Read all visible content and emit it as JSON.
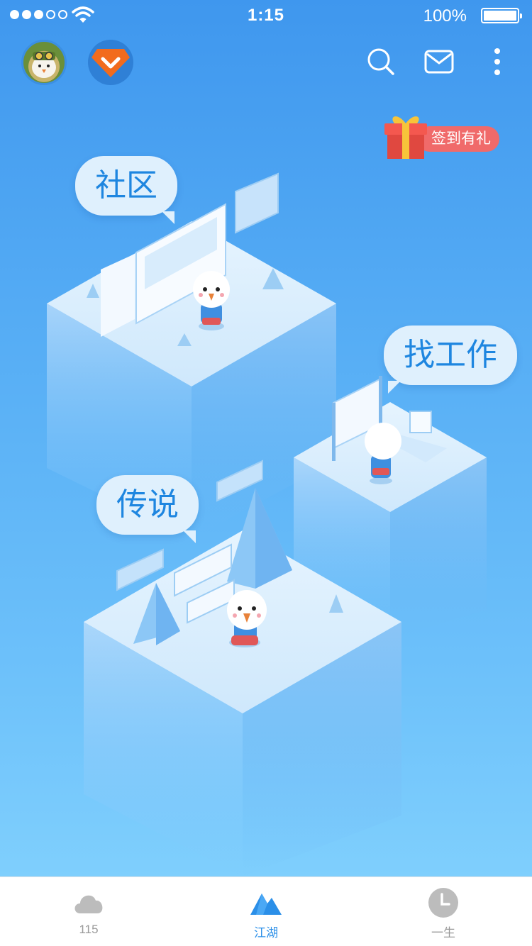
{
  "status_bar": {
    "time": "1:15",
    "battery_text": "100%",
    "signal_bars_filled": 3,
    "signal_bars_total": 5
  },
  "top_bar": {
    "icons": [
      "avatar",
      "vip-diamond-icon",
      "search-icon",
      "mail-icon",
      "more-vertical-icon"
    ]
  },
  "gift": {
    "label": "签到有礼"
  },
  "sections": {
    "community": "社区",
    "job": "找工作",
    "legend": "传说"
  },
  "tab_bar": {
    "tabs": [
      {
        "label": "115",
        "icon": "cloud-icon"
      },
      {
        "label": "江湖",
        "icon": "mountain-icon"
      },
      {
        "label": "一生",
        "icon": "clock-icon"
      }
    ],
    "active_index": 1
  },
  "colors": {
    "background_top": "#3f97ee",
    "background_bottom": "#7fcffd",
    "accent_blue": "#2b8fe8",
    "vip_orange": "#f26b1d",
    "gift_red": "#f06a6a",
    "bubble_bg": "#dff0fd",
    "bubble_text": "#1e86e0",
    "tab_inactive": "#9a9a9a"
  }
}
